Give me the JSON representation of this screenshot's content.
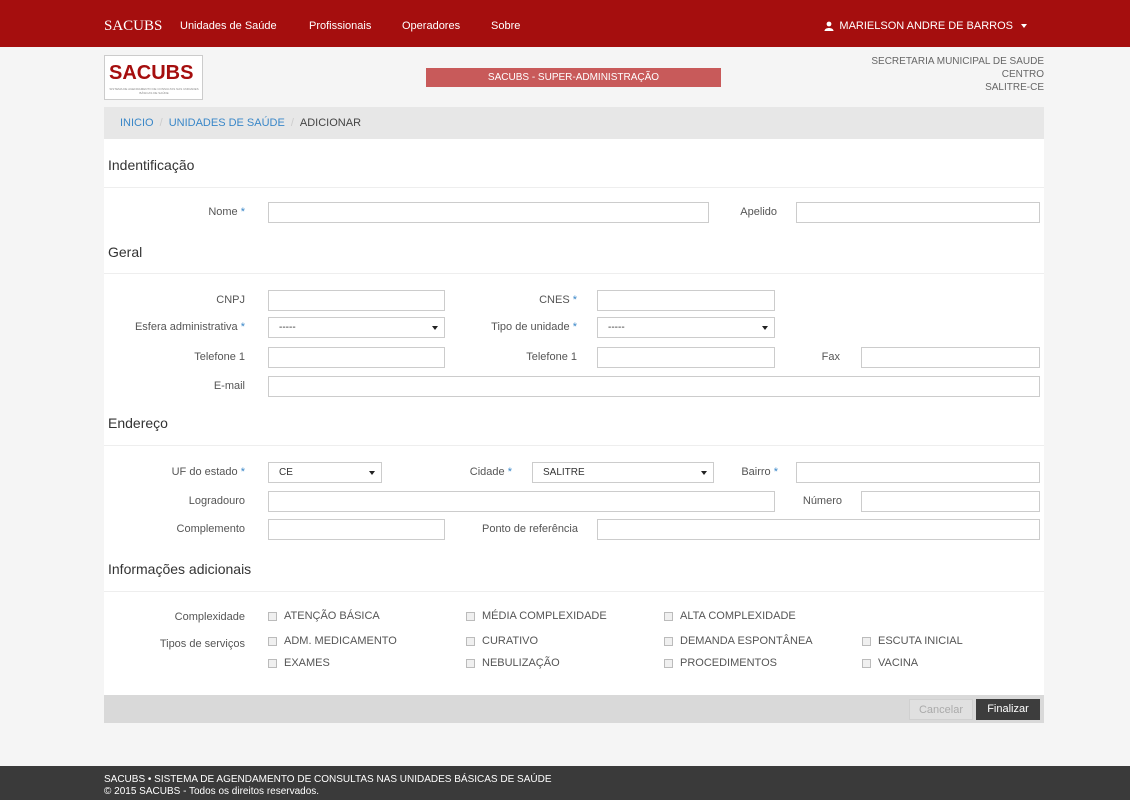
{
  "navbar": {
    "brand": "SACUBS",
    "links": [
      "Unidades de Saúde",
      "Profissionais",
      "Operadores",
      "Sobre"
    ],
    "user": "MARIELSON ANDRE DE BARROS"
  },
  "header": {
    "logo_text": "SACUBS",
    "logo_subtext": "SISTEMA DE AGENDAMENTO DE CONSULTAS NAS UNIDADES BÁSICAS DE SAÚDE",
    "banner": "SACUBS - SUPER-ADMINISTRAÇÃO",
    "secretaria_line1": "SECRETARIA MUNICIPAL DE SAUDE",
    "secretaria_line2": "CENTRO",
    "secretaria_line3": "SALITRE-CE"
  },
  "breadcrumb": {
    "home": "INICIO",
    "section": "UNIDADES DE SAÚDE",
    "current": "ADICIONAR"
  },
  "sections": {
    "identificacao": "Indentificação",
    "geral": "Geral",
    "endereco": "Endereço",
    "adicionais": "Informações adicionais"
  },
  "fields": {
    "nome": "Nome",
    "apelido": "Apelido",
    "cnpj": "CNPJ",
    "cnes": "CNES",
    "esfera": "Esfera administrativa",
    "tipo_unidade": "Tipo de unidade",
    "telefone1": "Telefone 1",
    "telefone2": "Telefone 1",
    "fax": "Fax",
    "email": "E-mail",
    "uf": "UF do estado",
    "cidade": "Cidade",
    "bairro": "Bairro",
    "logradouro": "Logradouro",
    "numero": "Número",
    "complemento": "Complemento",
    "ponto_referencia": "Ponto de referência",
    "complexidade": "Complexidade",
    "tipos_servicos": "Tipos de serviços",
    "required_mark": "*"
  },
  "selects": {
    "esfera_value": "-----",
    "tipo_unidade_value": "-----",
    "uf_value": "CE",
    "cidade_value": "SALITRE"
  },
  "complexidade_options": [
    "ATENÇÃO BÁSICA",
    "MÉDIA COMPLEXIDADE",
    "ALTA COMPLEXIDADE"
  ],
  "servicos_options": [
    "ADM. MEDICAMENTO",
    "CURATIVO",
    "DEMANDA ESPONTÂNEA",
    "ESCUTA INICIAL",
    "EXAMES",
    "NEBULIZAÇÃO",
    "PROCEDIMENTOS",
    "VACINA"
  ],
  "actions": {
    "cancel": "Cancelar",
    "submit": "Finalizar"
  },
  "footer": {
    "line1": "SACUBS • SISTEMA DE AGENDAMENTO DE CONSULTAS NAS UNIDADES BÁSICAS DE SAÚDE",
    "line2": "© 2015 SACUBS - Todos os direitos reservados."
  }
}
